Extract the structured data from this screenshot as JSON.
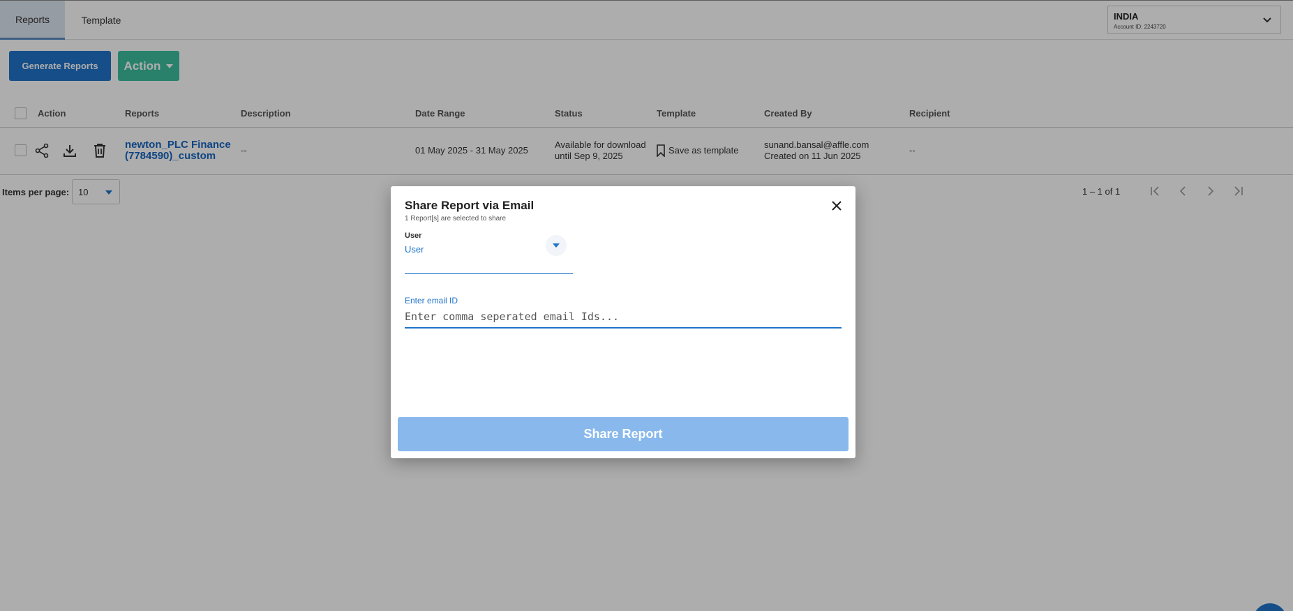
{
  "tabs": [
    {
      "label": "Reports",
      "active": true
    },
    {
      "label": "Template",
      "active": false
    }
  ],
  "account": {
    "name": "INDIA",
    "id_text": "Account ID: 2243720"
  },
  "toolbar": {
    "generate_label": "Generate Reports",
    "action_label": "Action"
  },
  "table": {
    "headers": [
      "Action",
      "Reports",
      "Description",
      "Date Range",
      "Status",
      "Template",
      "Created By",
      "Recipient"
    ],
    "rows": [
      {
        "report_line1": "newton_PLC Finance",
        "report_line2": "(7784590)_custom",
        "description": "--",
        "date_range": "01 May 2025 - 31 May 2025",
        "status_line1": "Available for download",
        "status_line2": "until Sep 9, 2025",
        "template": "Save as template",
        "created_by": "sunand.bansal@affle.com",
        "created_on": "Created on 11 Jun 2025",
        "recipient": "--"
      }
    ]
  },
  "pagination": {
    "items_label": "Items per page:",
    "items_value": "10",
    "range": "1 – 1 of 1"
  },
  "dialog": {
    "title": "Share Report via Email",
    "subtitle": "1 Report[s] are selected to share",
    "user_label": "User",
    "user_value": "User",
    "email_label": "Enter email ID",
    "email_placeholder": "Enter comma seperated email Ids...",
    "share_label": "Share Report"
  },
  "colors": {
    "primary": "#1f73c9",
    "action": "#3dbfa0",
    "share_disabled": "#89b9ec"
  }
}
